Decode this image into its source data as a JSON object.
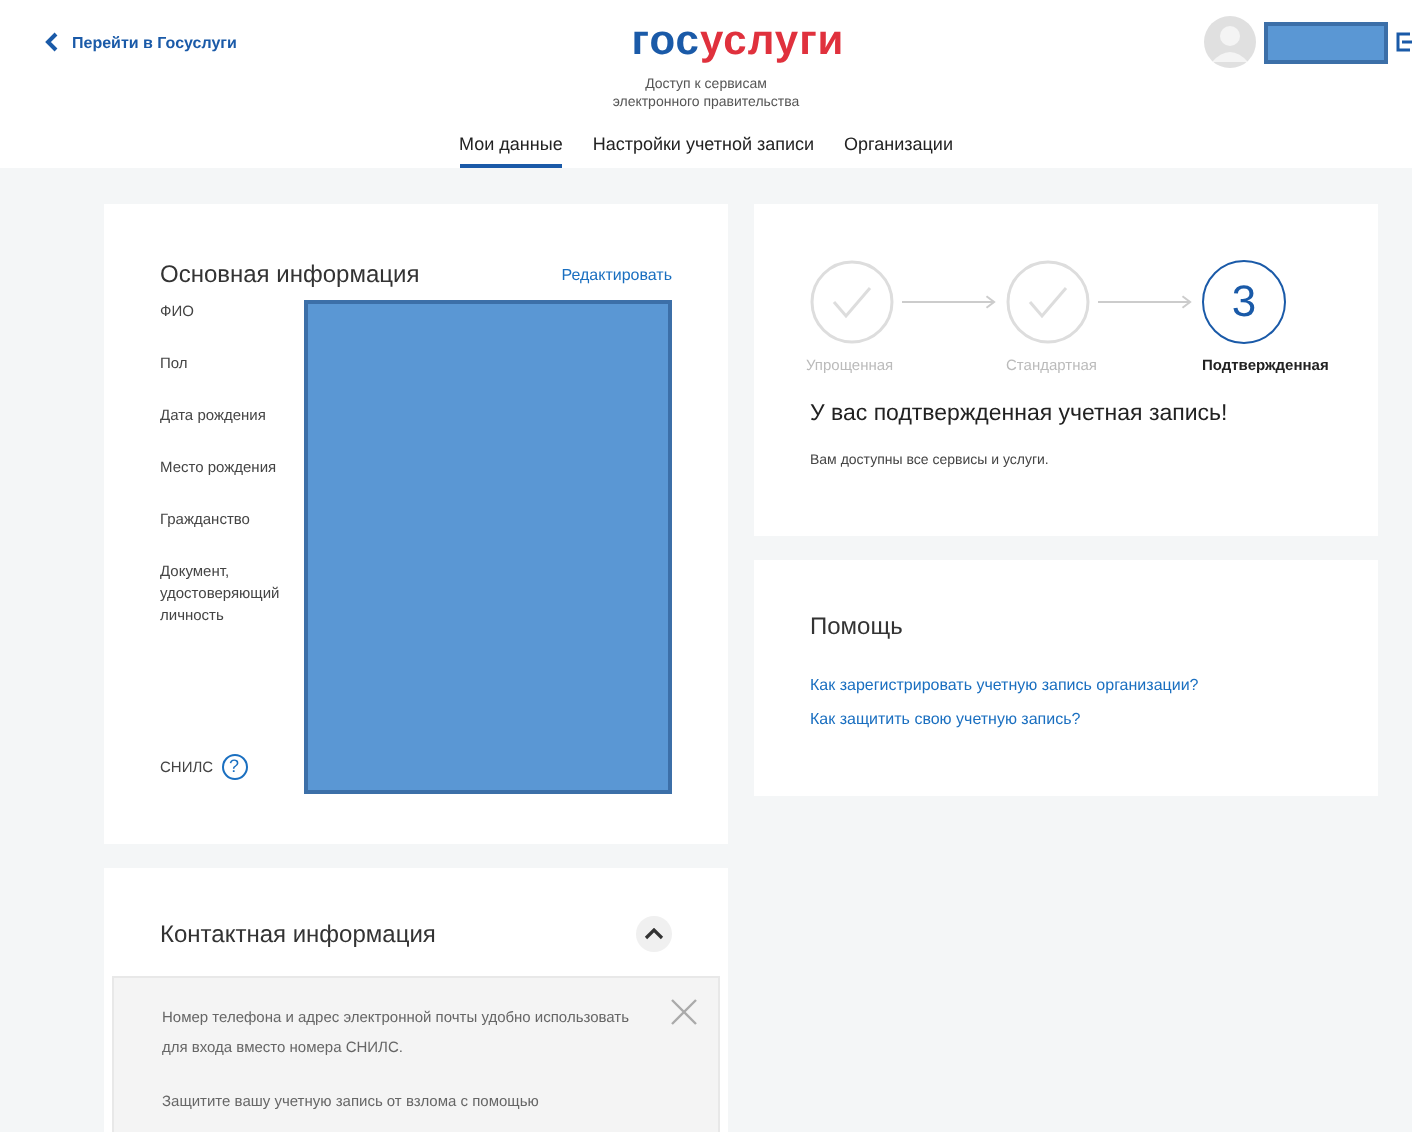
{
  "header": {
    "back_link": "Перейти в Госуслуги",
    "logo": [
      {
        "text": "гос",
        "kind": "blue"
      },
      {
        "text": "услуги",
        "kind": "red"
      }
    ],
    "subtitle": "Доступ к сервисам электронного правительства"
  },
  "tabs": [
    {
      "label": "Мои данные",
      "selected": true
    },
    {
      "label": "Настройки учетной записи",
      "selected": false
    },
    {
      "label": "Организации",
      "selected": false
    }
  ],
  "basic_info": {
    "title": "Основная информация",
    "edit_link": "Редактировать",
    "fields": [
      {
        "label": "ФИО"
      },
      {
        "label": "Пол"
      },
      {
        "label": "Дата рождения"
      },
      {
        "label": "Место рождения"
      },
      {
        "label": "Гражданство"
      },
      {
        "label": "Документ, удостоверяющий личность",
        "kind": "tall"
      },
      {
        "label": "СНИЛС",
        "kind": "help"
      }
    ],
    "help_icon": "?"
  },
  "account_level": {
    "steps": [
      {
        "label": "Упрощенная",
        "selected": false
      },
      {
        "label": "Стандартная",
        "selected": false
      },
      {
        "label": "Подтвержденная",
        "selected": true,
        "mark": "3"
      }
    ],
    "heading": "У вас подтвержденная учетная запись!",
    "text": "Вам доступны все сервисы и услуги."
  },
  "help": {
    "title": "Помощь",
    "links": [
      "Как зарегистрировать учетную запись организации?",
      "Как защитить свою учетную запись?"
    ]
  },
  "contact_info": {
    "title": "Контактная информация",
    "expanded": true,
    "notice": [
      "Номер телефона и адрес электронной почты удобно использовать для входа вместо номера СНИЛС.",
      "Защитите вашу учетную запись от взлома с помощью"
    ]
  }
}
